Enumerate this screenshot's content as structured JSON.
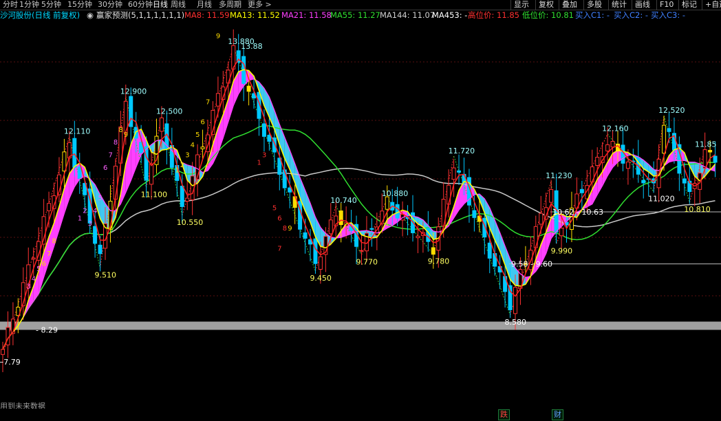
{
  "toolbar": {
    "periods": [
      "分时",
      "1分钟",
      "5分钟",
      "15分钟",
      "30分钟",
      "60分钟",
      "日线",
      "周线",
      "月线",
      "多周期",
      "更多 >"
    ],
    "active_period": "日线",
    "tools": [
      "显示",
      "复权",
      "叠加",
      "多股",
      "统计",
      "画线",
      "F10",
      "标记",
      "+自选"
    ],
    "arrow_glyphs": [
      "<",
      ">",
      "◇"
    ]
  },
  "info": {
    "stock": "沙河股份(日线 前复权)",
    "indicator": "赢家预测(5,1,1,1,1,1,1)",
    "ma8": "MA8: 11.59",
    "ma13": "MA13: 11.52",
    "ma21": "MA21: 11.58",
    "ma55": "MA55: 11.27",
    "ma144": "MA144: 11.07",
    "ma453": "MA453: -",
    "high_label": "高位价: 11.85",
    "low_label": "低位价: 10.81",
    "buy1": "买入C1: -",
    "buy2": "买入C2: -",
    "buy3": "买入C3: -"
  },
  "colors": {
    "up": "#ff3232",
    "down": "#00c8ff",
    "yellow": "#ffdc00",
    "ma8": "#ff2020",
    "ma13": "#ffff00",
    "ma21": "#ff40ff",
    "ma55": "#30e030",
    "ma144": "#c8c8c8",
    "ribbon_up": "#ff40ff",
    "ribbon_down": "#40c8f0"
  },
  "chart_data": {
    "type": "candlestick",
    "y_range": [
      7.6,
      14.4
    ],
    "pivots": [
      {
        "label": "13.880",
        "v": 13.88,
        "i": 45,
        "pos": "top"
      },
      {
        "label": "13.88",
        "v": 13.88,
        "i": 47,
        "pos": "right"
      },
      {
        "label": "12.900",
        "v": 12.9,
        "i": 24,
        "pos": "top"
      },
      {
        "label": "12.500",
        "v": 12.5,
        "i": 31,
        "pos": "top"
      },
      {
        "label": "12.110",
        "v": 12.11,
        "i": 13,
        "pos": "top"
      },
      {
        "label": "11.100",
        "v": 11.1,
        "i": 28,
        "pos": "below"
      },
      {
        "label": "10.550",
        "v": 10.55,
        "i": 35,
        "pos": "below"
      },
      {
        "label": "9.510",
        "v": 9.51,
        "i": 19,
        "pos": "below"
      },
      {
        "label": "9.450",
        "v": 9.45,
        "i": 61,
        "pos": "below"
      },
      {
        "label": "10.740",
        "v": 10.74,
        "i": 65,
        "pos": "top"
      },
      {
        "label": "9.770",
        "v": 9.77,
        "i": 70,
        "pos": "below"
      },
      {
        "label": "10.880",
        "v": 10.88,
        "i": 75,
        "pos": "top"
      },
      {
        "label": "9.780",
        "v": 9.78,
        "i": 84,
        "pos": "below"
      },
      {
        "label": "11.720",
        "v": 11.72,
        "i": 88,
        "pos": "top"
      },
      {
        "label": "8.580",
        "v": 8.58,
        "i": 99,
        "pos": "below"
      },
      {
        "label": "11.230",
        "v": 11.23,
        "i": 107,
        "pos": "top"
      },
      {
        "label": "9.990",
        "v": 9.99,
        "i": 108,
        "pos": "below"
      },
      {
        "label": "12.160",
        "v": 12.16,
        "i": 118,
        "pos": "top"
      },
      {
        "label": "11.020",
        "v": 11.02,
        "i": 127,
        "pos": "below"
      },
      {
        "label": "12.520",
        "v": 12.52,
        "i": 129,
        "pos": "top"
      },
      {
        "label": "10.810",
        "v": 10.81,
        "i": 134,
        "pos": "below"
      },
      {
        "label": "11.85",
        "v": 11.85,
        "i": 137,
        "pos": "top"
      },
      {
        "label": "←7.79",
        "v": 7.79,
        "i": 0,
        "pos": "below"
      }
    ],
    "range_labels": [
      {
        "text": "10.62 - 10.63",
        "v": 10.62,
        "x_start": 800
      },
      {
        "text": "9.58 - 9.60",
        "v": 9.59,
        "x_start": 740
      },
      {
        "text": "- 8.29",
        "v": 8.29,
        "x_start": 0
      }
    ],
    "count_labels": [
      {
        "text": "9",
        "i": 42,
        "v": 14.05,
        "c": "y"
      },
      {
        "text": "8",
        "i": 23,
        "v": 12.2,
        "c": "y"
      },
      {
        "text": "9",
        "i": 24,
        "v": 12.1,
        "c": "y"
      },
      {
        "text": "7",
        "i": 40,
        "v": 12.75,
        "c": "y"
      },
      {
        "text": "6",
        "i": 39,
        "v": 12.35,
        "c": "y"
      },
      {
        "text": "5",
        "i": 38,
        "v": 12.1,
        "c": "y"
      },
      {
        "text": "4",
        "i": 37,
        "v": 11.9,
        "c": "y"
      },
      {
        "text": "3",
        "i": 36,
        "v": 11.7,
        "c": "y"
      },
      {
        "text": "2",
        "i": 35,
        "v": 11.5,
        "c": "y"
      },
      {
        "text": "1",
        "i": 34,
        "v": 11.4,
        "c": "y"
      },
      {
        "text": "8",
        "i": 22,
        "v": 11.95,
        "c": "m"
      },
      {
        "text": "7",
        "i": 21,
        "v": 11.7,
        "c": "m"
      },
      {
        "text": "6",
        "i": 20,
        "v": 11.45,
        "c": "m"
      },
      {
        "text": "5",
        "i": 19,
        "v": 10.85,
        "c": "m"
      },
      {
        "text": "4",
        "i": 18,
        "v": 10.6,
        "c": "m"
      },
      {
        "text": "3",
        "i": 17,
        "v": 10.35,
        "c": "m"
      },
      {
        "text": "2",
        "i": 16,
        "v": 10.6,
        "c": "m"
      },
      {
        "text": "1",
        "i": 15,
        "v": 10.45,
        "c": "m"
      },
      {
        "text": "8",
        "i": 10,
        "v": 10.0,
        "c": "y"
      },
      {
        "text": "7",
        "i": 9,
        "v": 9.75,
        "c": "y"
      },
      {
        "text": "6",
        "i": 8,
        "v": 9.55,
        "c": "y"
      },
      {
        "text": "5",
        "i": 7,
        "v": 9.45,
        "c": "m"
      },
      {
        "text": "4",
        "i": 6,
        "v": 9.25,
        "c": "m"
      },
      {
        "text": "3",
        "i": 5,
        "v": 9.1,
        "c": "m"
      },
      {
        "text": "1",
        "i": 50,
        "v": 11.55,
        "c": "r"
      },
      {
        "text": "3",
        "i": 51,
        "v": 11.7,
        "c": "r"
      },
      {
        "text": "5",
        "i": 53,
        "v": 10.65,
        "c": "r"
      },
      {
        "text": "6",
        "i": 54,
        "v": 10.45,
        "c": "r"
      },
      {
        "text": "8",
        "i": 55,
        "v": 10.25,
        "c": "r"
      },
      {
        "text": "9",
        "i": 56,
        "v": 10.25,
        "c": "y"
      },
      {
        "text": "7",
        "i": 54,
        "v": 9.85,
        "c": "r"
      }
    ],
    "candles_note": "approximate OHLC series estimated from pixels",
    "future_note": "用到未来数据",
    "flags": [
      {
        "text": "跌",
        "x": 724
      },
      {
        "text": "财",
        "x": 802
      }
    ]
  }
}
